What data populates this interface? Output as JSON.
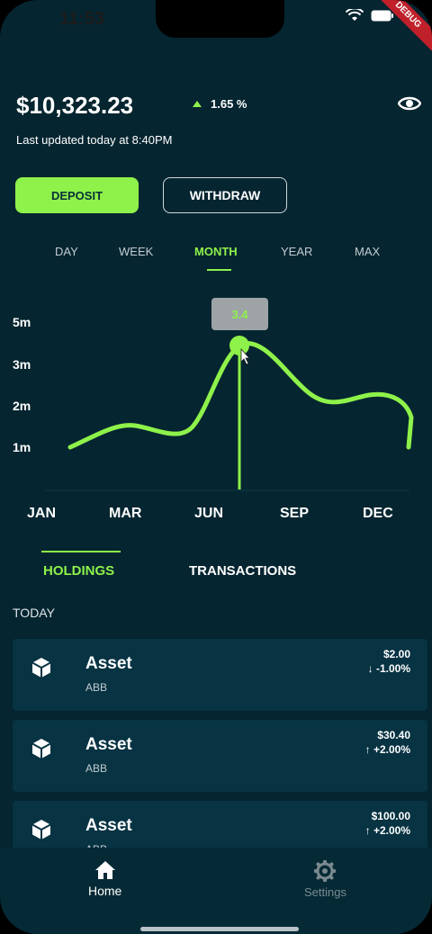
{
  "status_bar": {
    "time": "11:53",
    "debug_label": "DEBUG"
  },
  "header": {
    "balance": "$10,323.23",
    "change_pct": "1.65 %",
    "last_updated": "Last updated today at 8:40PM"
  },
  "actions": {
    "deposit_label": "DEPOSIT",
    "withdraw_label": "WITHDRAW"
  },
  "range_tabs": [
    "DAY",
    "WEEK",
    "MONTH",
    "YEAR",
    "MAX"
  ],
  "range_tabs_active": "MONTH",
  "chart_data": {
    "type": "line",
    "x": [
      "JAN",
      "MAR",
      "JUN",
      "SEP",
      "DEC"
    ],
    "y_ticks": [
      "5m",
      "3m",
      "2m",
      "1m"
    ],
    "selected_label": "3.4",
    "selected_month": "JUN",
    "line_color": "#8ef24a"
  },
  "section_tabs": {
    "holdings_label": "HOLDINGS",
    "transactions_label": "TRANSACTIONS"
  },
  "list": {
    "heading": "TODAY",
    "items": [
      {
        "name": "Asset",
        "ticker": "ABB",
        "price": "$2.00",
        "change": "-1.00%",
        "direction": "down"
      },
      {
        "name": "Asset",
        "ticker": "ABB",
        "price": "$30.40",
        "change": "+2.00%",
        "direction": "up"
      },
      {
        "name": "Asset",
        "ticker": "ABB",
        "price": "$100.00",
        "change": "+2.00%",
        "direction": "up"
      }
    ]
  },
  "bottom_nav": {
    "home_label": "Home",
    "settings_label": "Settings"
  },
  "colors": {
    "background": "#052530",
    "accent": "#8ef24a",
    "card": "#073343"
  }
}
